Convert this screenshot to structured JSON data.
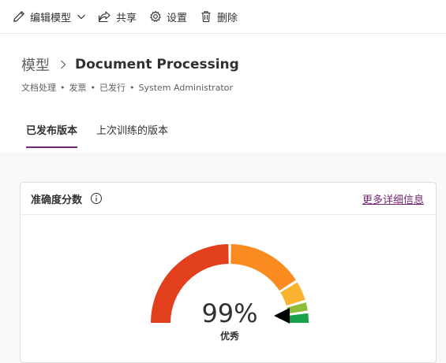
{
  "toolbar": {
    "edit_model_label": "编辑模型",
    "share_label": "共享",
    "settings_label": "设置",
    "delete_label": "删除"
  },
  "breadcrumb": {
    "parent": "模型",
    "current": "Document Processing"
  },
  "subtitle": {
    "type": "文档处理",
    "kind": "发票",
    "status": "已发行",
    "owner": "System Administrator",
    "separator": "•"
  },
  "tabs": [
    {
      "label": "已发布版本",
      "active": true
    },
    {
      "label": "上次训练的版本",
      "active": false
    }
  ],
  "accuracy_card": {
    "title": "准确度分数",
    "more_link": "更多详细信息",
    "score_text": "99%",
    "grade": "优秀",
    "score_value": 99
  },
  "gauge_colors": {
    "poor": "#e2401c",
    "fair": "#f98b21",
    "average": "#fbb431",
    "good": "#8dbd38",
    "excellent": "#19a24b",
    "needle": "#000000"
  },
  "accent_color": "#742774"
}
